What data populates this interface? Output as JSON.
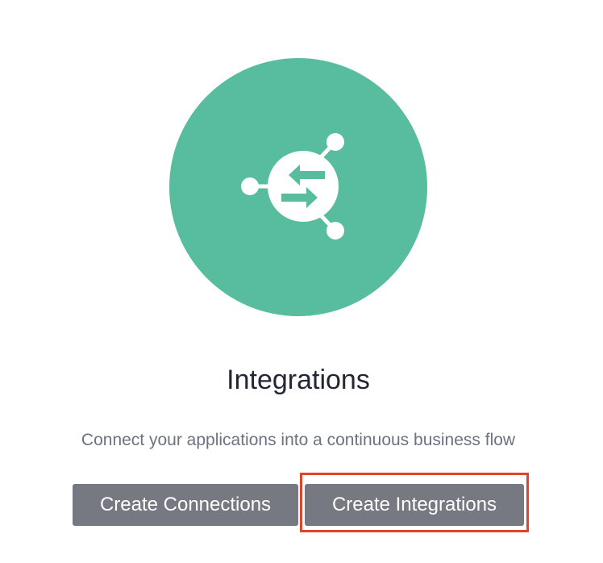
{
  "hero": {
    "icon": "integrations-hub-icon",
    "circle_color": "#58bc9f"
  },
  "title": "Integrations",
  "subtitle": "Connect your applications into a continuous business flow",
  "buttons": {
    "create_connections": "Create Connections",
    "create_integrations": "Create Integrations"
  },
  "colors": {
    "button_bg": "#767882",
    "highlight": "#e2432c"
  }
}
